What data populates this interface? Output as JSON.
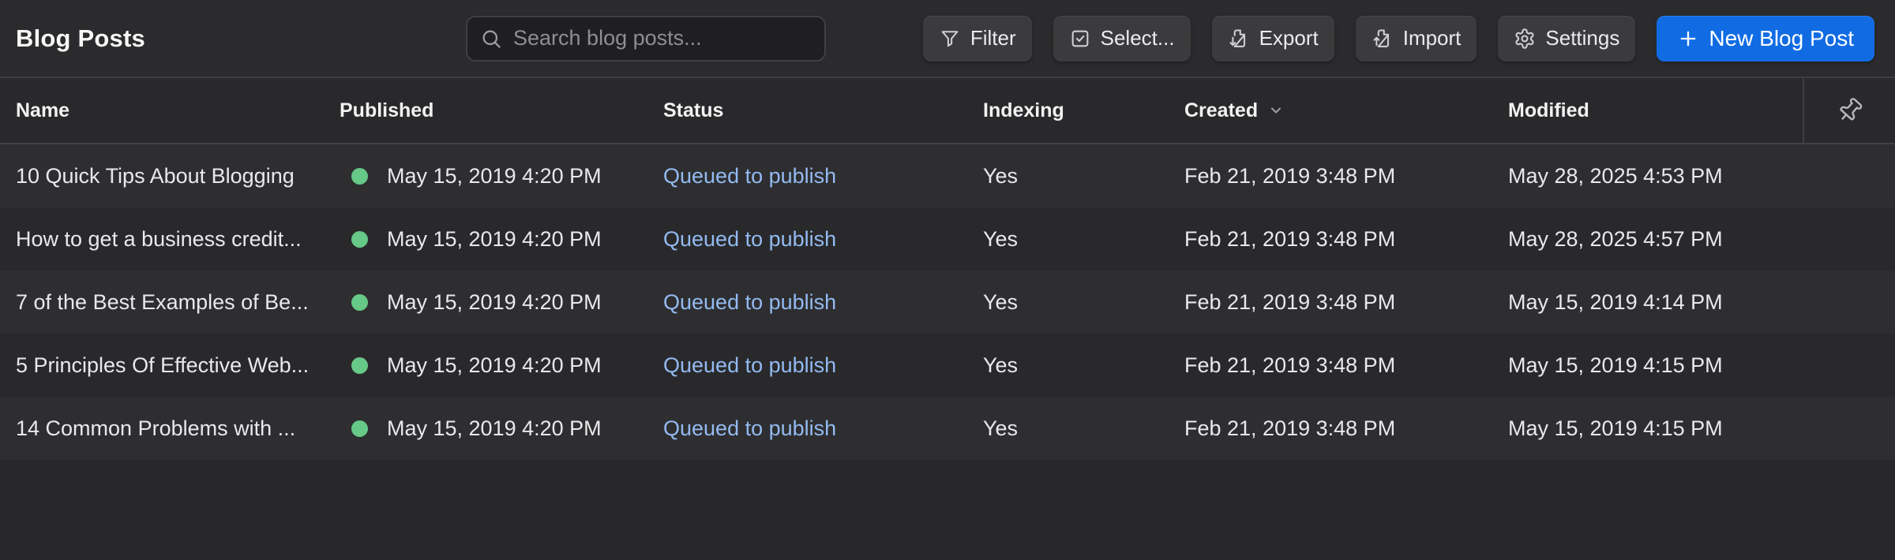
{
  "header": {
    "title": "Blog Posts",
    "search": {
      "placeholder": "Search blog posts..."
    },
    "buttons": [
      {
        "label": "Filter",
        "icon": "filter-icon"
      },
      {
        "label": "Select...",
        "icon": "checkbox-icon"
      },
      {
        "label": "Export",
        "icon": "export-icon"
      },
      {
        "label": "Import",
        "icon": "import-icon"
      },
      {
        "label": "Settings",
        "icon": "gear-icon"
      }
    ],
    "primary_button": {
      "label": "New Blog Post",
      "icon": "plus-icon"
    }
  },
  "table": {
    "columns": {
      "name": "Name",
      "published": "Published",
      "status": "Status",
      "indexing": "Indexing",
      "created": "Created",
      "modified": "Modified"
    },
    "sorted_by": "Created",
    "rows": [
      {
        "name": "10 Quick Tips About Blogging",
        "published": "May 15, 2019 4:20 PM",
        "status": "Queued to publish",
        "indexing": "Yes",
        "created": "Feb 21, 2019 3:48 PM",
        "modified": "May 28, 2025 4:53 PM"
      },
      {
        "name": "How to get a business credit...",
        "published": "May 15, 2019 4:20 PM",
        "status": "Queued to publish",
        "indexing": "Yes",
        "created": "Feb 21, 2019 3:48 PM",
        "modified": "May 28, 2025 4:57 PM"
      },
      {
        "name": "7 of the Best Examples of Be...",
        "published": "May 15, 2019 4:20 PM",
        "status": "Queued to publish",
        "indexing": "Yes",
        "created": "Feb 21, 2019 3:48 PM",
        "modified": "May 15, 2019 4:14 PM"
      },
      {
        "name": "5 Principles Of Effective Web...",
        "published": "May 15, 2019 4:20 PM",
        "status": "Queued to publish",
        "indexing": "Yes",
        "created": "Feb 21, 2019 3:48 PM",
        "modified": "May 15, 2019 4:15 PM"
      },
      {
        "name": "14 Common Problems with ...",
        "published": "May 15, 2019 4:20 PM",
        "status": "Queued to publish",
        "indexing": "Yes",
        "created": "Feb 21, 2019 3:48 PM",
        "modified": "May 15, 2019 4:15 PM"
      }
    ]
  },
  "colors": {
    "accent_blue": "#116ce4",
    "status_link_blue": "#93baf1",
    "published_dot_green": "#66c987"
  }
}
